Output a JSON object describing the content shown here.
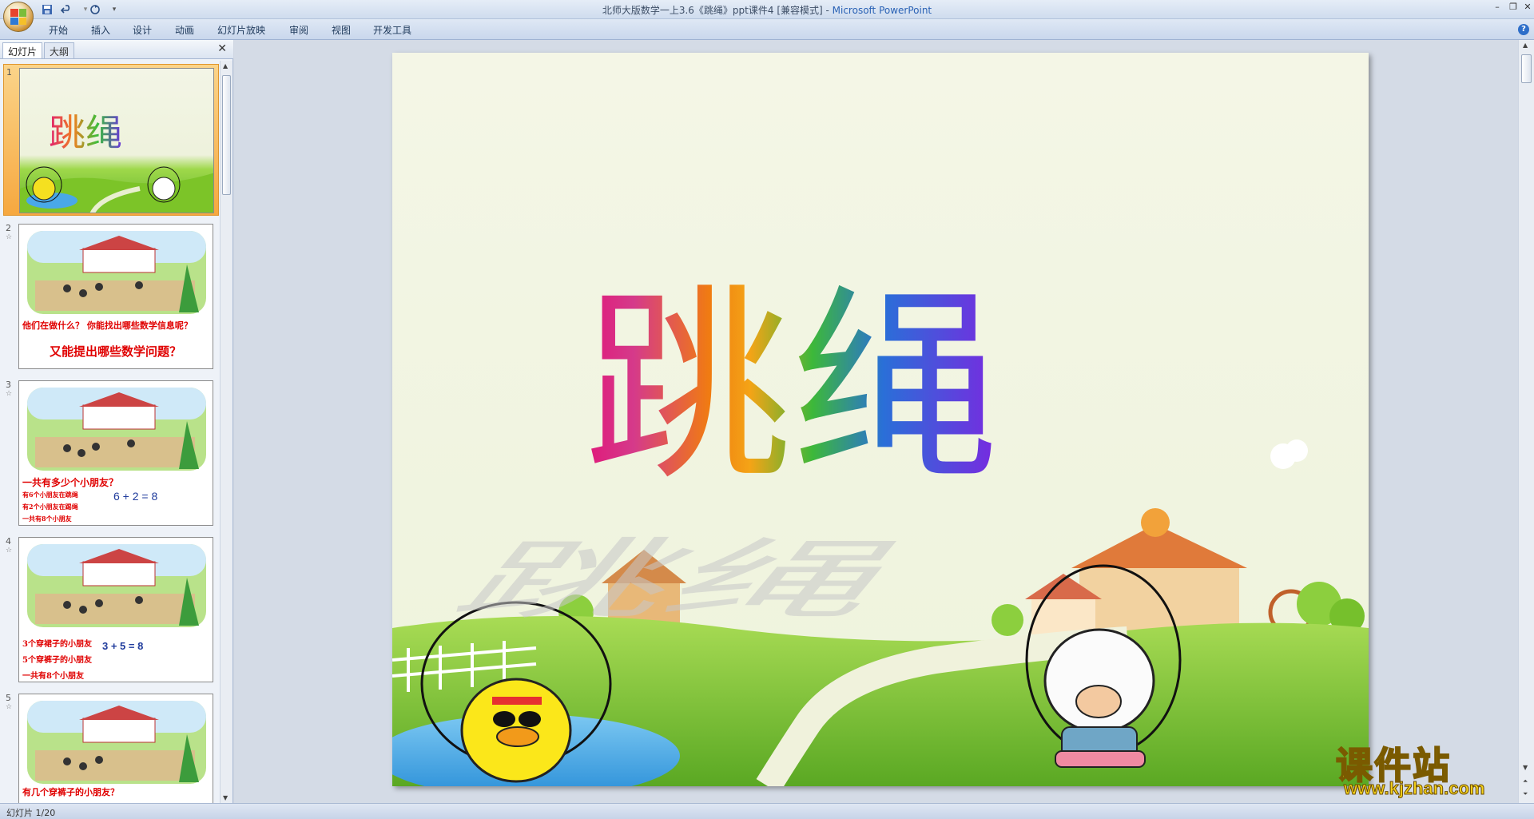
{
  "window": {
    "title_doc": "北师大版数学一上3.6《跳绳》ppt课件4 [兼容模式] - ",
    "title_app": "Microsoft PowerPoint",
    "min": "–",
    "max": "❐",
    "close": "✕"
  },
  "qat": {
    "save_icon": "save-icon",
    "undo_icon": "undo-icon",
    "redo_icon": "redo-icon"
  },
  "ribbon": {
    "tabs": [
      "开始",
      "插入",
      "设计",
      "动画",
      "幻灯片放映",
      "审阅",
      "视图",
      "开发工具"
    ],
    "help": "?"
  },
  "panel": {
    "tab_slides": "幻灯片",
    "tab_outline": "大纲",
    "close": "✕"
  },
  "slides": [
    {
      "num": "1",
      "title": "跳绳"
    },
    {
      "num": "2",
      "line1": "他们在做什么？ 你能找出哪些数学信息呢？",
      "line2": "又能提出哪些数学问题？"
    },
    {
      "num": "3",
      "line1": "一共有多少个小朋友？",
      "line2": "有6个小朋友在跳绳",
      "line3": "有2个小朋友在踢绳",
      "line4": "一共有8个小朋友",
      "equation": "6 + 2 = 8"
    },
    {
      "num": "4",
      "line1": "3个穿裙子的小朋友",
      "line2": "5个穿裤子的小朋友",
      "line3": "一共有8个小朋友",
      "equation": "3 + 5 = 8"
    },
    {
      "num": "5",
      "line1": "有几个穿裤子的小朋友？"
    }
  ],
  "main_slide": {
    "title": "跳绳"
  },
  "status": {
    "text": "幻灯片 1/20"
  },
  "watermark": {
    "big": "课件站",
    "url": "www.kjzhan.com"
  },
  "colors": {
    "accent": "#2a62b5",
    "active_thumb": "#f6a83f",
    "slide_bg": "#f5f6ec",
    "grass": "#7cc428"
  }
}
